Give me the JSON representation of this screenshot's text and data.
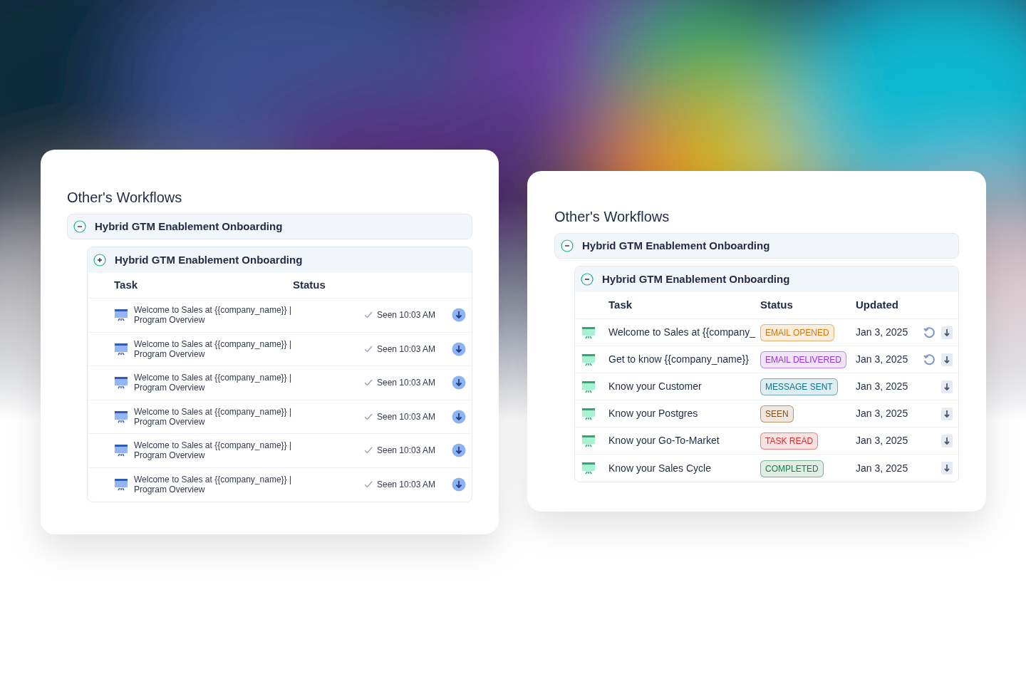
{
  "left_card": {
    "title": "Other's Workflows",
    "workflow": {
      "name": "Hybrid GTM Enablement Onboarding",
      "expanded": true
    },
    "group": {
      "name": "Hybrid GTM Enablement Onboarding",
      "expanded": false
    },
    "columns": [
      "Task",
      "Status"
    ],
    "rows": [
      {
        "line1": "Welcome to Sales at {{company_name}} |",
        "line2": "Program Overview",
        "status": "Seen 10:03 AM"
      },
      {
        "line1": "Welcome to Sales at {{company_name}} |",
        "line2": "Program Overview",
        "status": "Seen 10:03 AM"
      },
      {
        "line1": "Welcome to Sales at {{company_name}} |",
        "line2": "Program Overview",
        "status": "Seen 10:03 AM"
      },
      {
        "line1": "Welcome to Sales at {{company_name}} |",
        "line2": "Program Overview",
        "status": "Seen 10:03 AM"
      },
      {
        "line1": "Welcome to Sales at {{company_name}} |",
        "line2": "Program Overview",
        "status": "Seen 10:03 AM"
      },
      {
        "line1": "Welcome to Sales at {{company_name}} |",
        "line2": "Program Overview",
        "status": "Seen 10:03 AM"
      }
    ]
  },
  "right_card": {
    "title": "Other's Workflows",
    "workflow": {
      "name": "Hybrid GTM Enablement Onboarding",
      "expanded": true
    },
    "group": {
      "name": "Hybrid GTM Enablement Onboarding",
      "expanded": true
    },
    "columns": [
      "Task",
      "Status",
      "Updated"
    ],
    "rows": [
      {
        "task": "Welcome to Sales at {{company_",
        "status": "EMAIL OPENED",
        "color": "#d97706",
        "updated": "Jan 3, 2025",
        "retry": true
      },
      {
        "task": "Get to know {{company_name}}",
        "status": "EMAIL DELIVERED",
        "color": "#9333ea",
        "updated": "Jan 3, 2025",
        "retry": true
      },
      {
        "task": "Know your Customer",
        "status": "MESSAGE SENT",
        "color": "#0e7490",
        "updated": "Jan 3, 2025",
        "retry": false
      },
      {
        "task": "Know your Postgres",
        "status": "SEEN",
        "color": "#854d0e",
        "updated": "Jan 3, 2025",
        "retry": false
      },
      {
        "task": "Know your Go-To-Market",
        "status": "TASK READ",
        "color": "#dc2626",
        "updated": "Jan 3, 2025",
        "retry": false
      },
      {
        "task": "Know your Sales Cycle",
        "status": "COMPLETED",
        "color": "#15803d",
        "updated": "Jan 3, 2025",
        "retry": false
      }
    ]
  }
}
